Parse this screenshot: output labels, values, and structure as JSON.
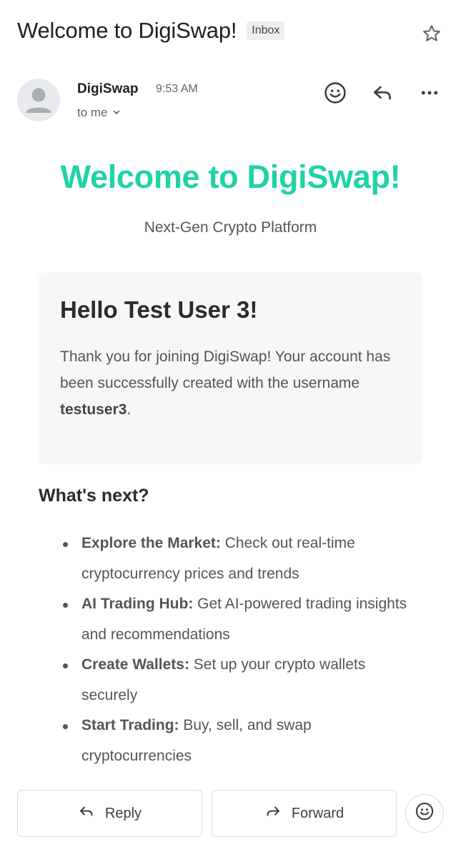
{
  "header": {
    "subject": "Welcome to DigiSwap!",
    "label_chip": "Inbox"
  },
  "sender": {
    "name": "DigiSwap",
    "time": "9:53 AM",
    "recipient": "to me"
  },
  "email": {
    "hero_title": "Welcome to DigiSwap!",
    "hero_subtitle": "Next-Gen Crypto Platform",
    "card": {
      "greeting": "Hello Test User 3!",
      "body_before": "Thank you for joining DigiSwap! Your account has been successfully created with the username ",
      "username": "testuser3",
      "body_after": "."
    },
    "next_title": "What's next?",
    "next_items": [
      {
        "title": "Explore the Market:",
        "text": " Check out real-time cryptocurrency prices and trends"
      },
      {
        "title": "AI Trading Hub:",
        "text": " Get AI-powered trading insights and recommendations"
      },
      {
        "title": "Create Wallets:",
        "text": " Set up your crypto wallets securely"
      },
      {
        "title": "Start Trading:",
        "text": " Buy, sell, and swap cryptocurrencies"
      }
    ]
  },
  "actions": {
    "reply_label": "Reply",
    "forward_label": "Forward"
  },
  "colors": {
    "brand": "#1fd3a4"
  },
  "icons": {
    "star": "star-icon",
    "emoji": "emoji-icon",
    "reply": "reply-icon",
    "more": "more-icon",
    "forward": "forward-icon",
    "chevron": "chevron-down-icon"
  }
}
